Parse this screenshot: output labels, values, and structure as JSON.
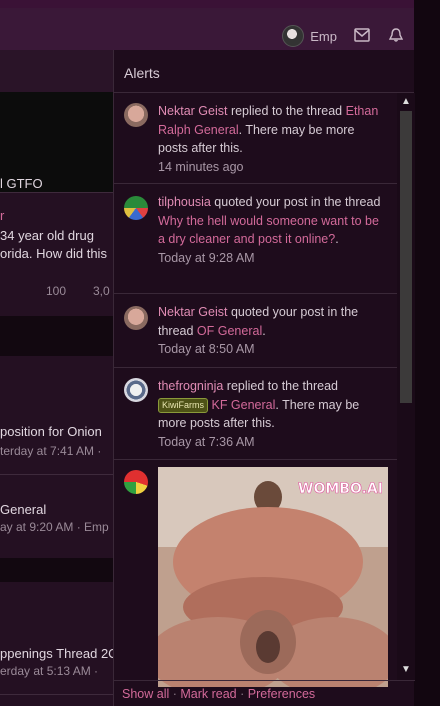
{
  "navbar": {
    "username": "Emp",
    "icons": [
      "user-avatar",
      "mail-icon",
      "bell-icon"
    ]
  },
  "background": {
    "row1": "l GTFO",
    "row2_link": "r",
    "row3": "34 year old drug",
    "row4": "orida. How did this",
    "stat1": "100",
    "stat2": "3,0",
    "row5": "position for Onion",
    "row5_meta": "terday at 7:41 AM ·",
    "row6": "General",
    "row6_meta": "ay at 9:20 AM · Emp",
    "row7": "ppenings Thread 2C",
    "row7_meta": "erday at 5:13 AM ·"
  },
  "alerts": {
    "title": "Alerts",
    "items": [
      {
        "user": "Nektar Geist",
        "action": " replied to the thread ",
        "thread": "Ethan Ralph General",
        "suffix": ". There may be more posts after this.",
        "time": "14 minutes ago"
      },
      {
        "user": "tilphousia",
        "action": " quoted your post in the thread ",
        "thread": "Why the hell would someone want to be a dry cleaner and post it online?",
        "suffix": ".",
        "time": "Today at 9:28 AM"
      },
      {
        "user": "Nektar Geist",
        "action": " quoted your post in the thread ",
        "thread": "OF General",
        "suffix": ".",
        "time": "Today at 8:50 AM"
      },
      {
        "user": "thefrogninja",
        "action": " replied to the thread ",
        "badge": "KiwiFarms",
        "thread": "KF General",
        "suffix": ". There may be more posts after this.",
        "time": "Today at 7:36 AM"
      }
    ],
    "image_watermark": "WOMBO.AI",
    "footer": {
      "show_all": "Show all",
      "mark_read": "Mark read",
      "preferences": "Preferences",
      "sep": " · "
    }
  }
}
